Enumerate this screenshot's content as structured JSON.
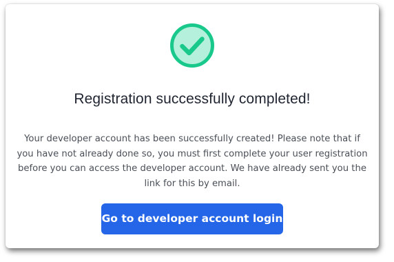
{
  "dialog": {
    "icon": "check-circle-icon",
    "title": "Registration successfully completed!",
    "message": "Your developer account has been successfully created! Please note that if you have not already done so, you must first complete your user registration before you can access the developer account. We have already sent you the link for this by email.",
    "button_label": "Go to developer account login"
  },
  "colors": {
    "success_ring": "#18c98b",
    "success_fill": "#b4f0db",
    "success_check": "#18c98b",
    "primary_button": "#2566e8"
  }
}
